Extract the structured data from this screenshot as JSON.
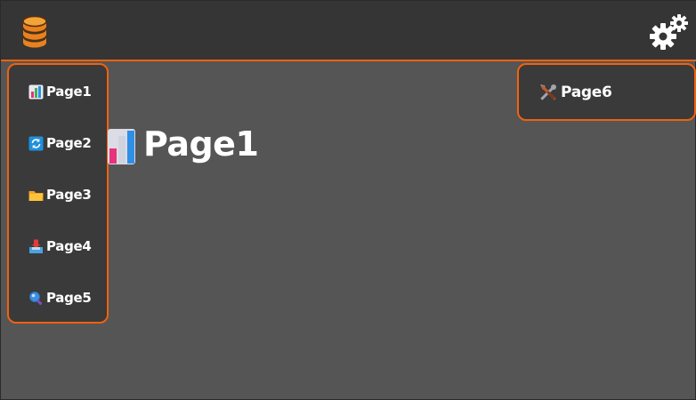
{
  "colors": {
    "accent": "#f0620f",
    "topbar": "#353535",
    "background": "#555555",
    "menu_background": "#3a3a3a",
    "text": "#ffffff"
  },
  "topbar": {
    "logo_icon": "database-icon",
    "settings_icon": "gears-icon"
  },
  "sidebar": {
    "items": [
      {
        "label": "Page1",
        "icon": "bar-chart-icon"
      },
      {
        "label": "Page2",
        "icon": "refresh-icon"
      },
      {
        "label": "Page3",
        "icon": "folder-icon"
      },
      {
        "label": "Page4",
        "icon": "inbox-tray-icon"
      },
      {
        "label": "Page5",
        "icon": "magnifier-icon"
      }
    ]
  },
  "settings_menu": {
    "items": [
      {
        "label": "Page6",
        "icon": "tools-icon"
      }
    ]
  },
  "main": {
    "title": "Page1",
    "title_icon": "bar-chart-icon"
  }
}
